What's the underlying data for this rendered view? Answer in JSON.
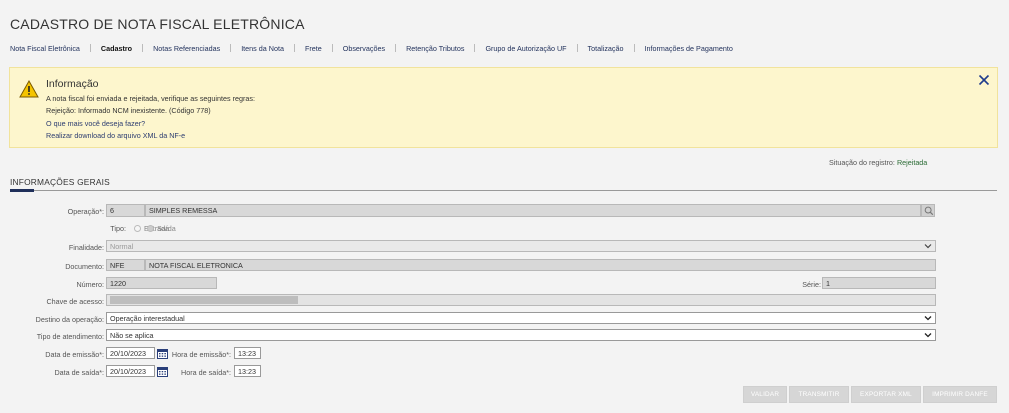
{
  "page": {
    "title": "CADASTRO DE NOTA FISCAL ELETRÔNICA"
  },
  "nav": {
    "tabs": [
      {
        "label": "Nota Fiscal Eletrônica",
        "active": false
      },
      {
        "label": "Cadastro",
        "active": true
      },
      {
        "label": "Notas Referenciadas",
        "active": false
      },
      {
        "label": "Itens da Nota",
        "active": false
      },
      {
        "label": "Frete",
        "active": false
      },
      {
        "label": "Observações",
        "active": false
      },
      {
        "label": "Retenção Tributos",
        "active": false
      },
      {
        "label": "Grupo de Autorização UF",
        "active": false
      },
      {
        "label": "Totalização",
        "active": false
      },
      {
        "label": "Informações de Pagamento",
        "active": false
      }
    ]
  },
  "alert": {
    "title": "Informação",
    "line1": "A nota fiscal foi enviada e rejeitada, verifique as seguintes regras:",
    "line2": "Rejeição: Informado NCM inexistente. (Código 778)",
    "line3": "O que mais você deseja fazer?",
    "line4": "Realizar download do arquivo XML da NF-e",
    "icon": "warning-icon",
    "close_icon": "close-icon"
  },
  "status": {
    "label": "Situação do registro:",
    "value": "Rejeitada"
  },
  "section": {
    "title": "INFORMAÇÕES GERAIS"
  },
  "form": {
    "operacao": {
      "label": "Operação*:",
      "code": "6",
      "name": "SIMPLES REMESSA"
    },
    "tipo": {
      "label": "Tipo:",
      "option_entrada": "Entrada",
      "option_saida": "Saída",
      "selected": "Saída"
    },
    "finalidade": {
      "label": "Finalidade:",
      "value": "Normal"
    },
    "documento": {
      "label": "Documento:",
      "code": "NFE",
      "name": "NOTA FISCAL ELETRONICA"
    },
    "numero": {
      "label": "Número:",
      "value": "1220"
    },
    "serie": {
      "label": "Série:",
      "value": "1"
    },
    "chave": {
      "label": "Chave de acesso:"
    },
    "destino": {
      "label": "Destino da operação:",
      "value": "Operação interestadual"
    },
    "atendimento": {
      "label": "Tipo de atendimento:",
      "value": "Não se aplica"
    },
    "data_emissao": {
      "label": "Data de emissão*:",
      "value": "20/10/2023"
    },
    "hora_emissao": {
      "label": "Hora de emissão*:",
      "value": "13:23"
    },
    "data_saida": {
      "label": "Data de saída*:",
      "value": "20/10/2023"
    },
    "hora_saida": {
      "label": "Hora de saída*:",
      "value": "13:23"
    }
  },
  "actions": {
    "validar": "VALIDAR",
    "transmitir": "TRANSMITIR",
    "exportar": "EXPORTAR XML",
    "imprimir": "IMPRIMIR DANFE"
  },
  "colors": {
    "brand": "#1f2f5a",
    "alert_bg": "#fdf6cd",
    "status_ok": "#2a6b34"
  }
}
